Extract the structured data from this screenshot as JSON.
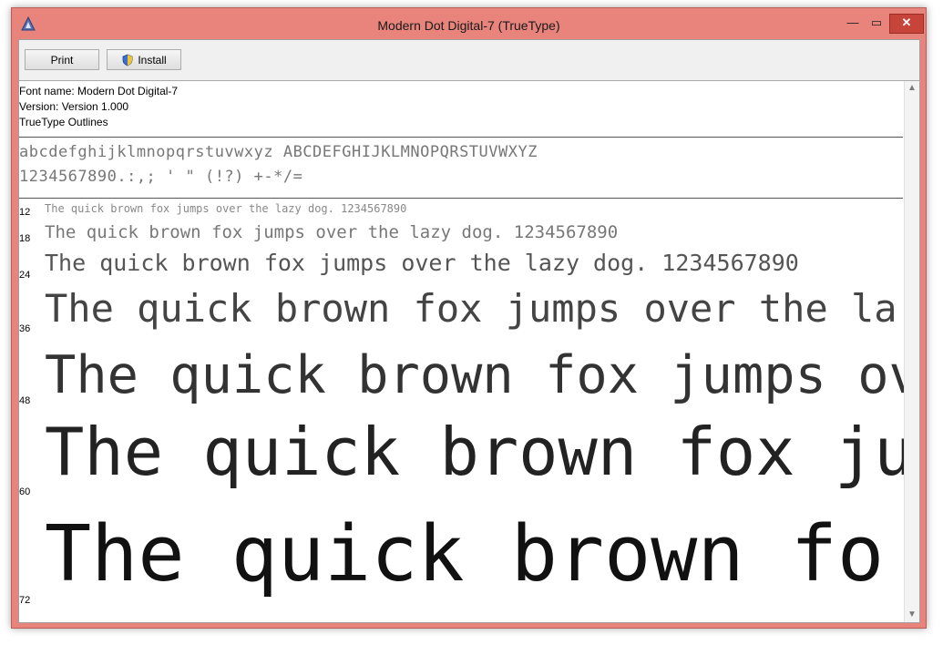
{
  "window": {
    "title": "Modern Dot Digital-7 (TrueType)",
    "controls": {
      "minimize": "—",
      "maximize": "▭",
      "close": "✕"
    }
  },
  "toolbar": {
    "print_label": "Print",
    "install_label": "Install"
  },
  "font_info": {
    "name": "Font name: Modern Dot Digital-7",
    "version": "Version: Version 1.000",
    "outlines": "TrueType Outlines"
  },
  "charset": {
    "line1": "abcdefghijklmnopqrstuvwxyz ABCDEFGHIJKLMNOPQRSTUVWXYZ",
    "line2": "1234567890.:,; ' \" (!?) +-*/="
  },
  "samples": [
    {
      "size": "12",
      "text": "The quick brown fox jumps over the lazy dog. 1234567890"
    },
    {
      "size": "18",
      "text": "The quick brown fox jumps over the lazy dog. 1234567890"
    },
    {
      "size": "24",
      "text": "The quick brown fox jumps over the lazy dog. 1234567890"
    },
    {
      "size": "36",
      "text": "The quick brown fox jumps over the la"
    },
    {
      "size": "48",
      "text": "The quick brown fox jumps ov"
    },
    {
      "size": "60",
      "text": "The quick brown fox jur"
    },
    {
      "size": "72",
      "text": "The quick brown fo"
    }
  ],
  "colors": {
    "title_bar": "#e8847c",
    "close_button": "#c7443a"
  }
}
